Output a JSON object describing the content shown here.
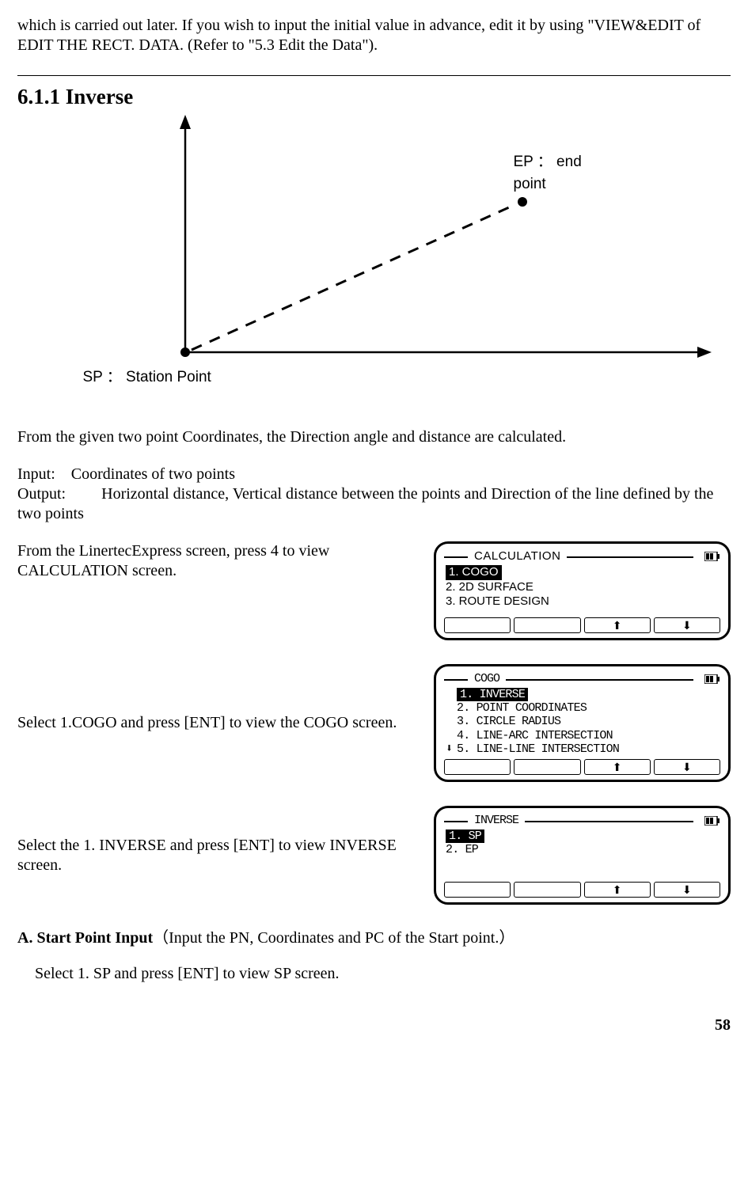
{
  "intro": "which is carried out later. If you wish to input the initial value in advance, edit it by using \"VIEW&EDIT of EDIT THE RECT. DATA. (Refer to \"5.3 Edit the Data\").",
  "section": {
    "heading": "6.1.1 Inverse"
  },
  "diagram": {
    "ep_label_line1": "EP ： end",
    "ep_label_line2": "point",
    "sp_label": "SP ： Station Point"
  },
  "body": {
    "desc": "From the given two point Coordinates, the Direction angle and distance are calculated.",
    "input_label": "Input:",
    "input_text": "Coordinates of two points",
    "output_label": "Output:",
    "output_text": "Horizontal distance, Vertical distance between the points and Direction of the line defined by the two points",
    "step1": "From the LinertecExpress screen, press 4 to view CALCULATION screen.",
    "step2": "Select 1.COGO and press [ENT] to view the COGO screen.",
    "step3": "Select the 1. INVERSE and press [ENT] to view INVERSE screen."
  },
  "screens": {
    "calc": {
      "title": "CALCULATION",
      "items": [
        "1. COGO",
        "2. 2D SURFACE",
        "3. ROUTE DESIGN"
      ],
      "selected_index": 0
    },
    "cogo": {
      "title": "COGO",
      "items": [
        "1. INVERSE",
        "2. POINT COORDINATES",
        "3. CIRCLE RADIUS",
        "4. LINE-ARC INTERSECTION",
        "5. LINE-LINE INTERSECTION"
      ],
      "selected_index": 0
    },
    "inverse": {
      "title": "INVERSE",
      "items": [
        "1. SP",
        "2. EP"
      ],
      "selected_index": 0
    },
    "arrows": {
      "up": "⬆",
      "down": "⬇",
      "down_marker": "⬇"
    }
  },
  "subA": {
    "heading_lead": "A.  Start Point Input",
    "heading_desc": "（Input the PN, Coordinates and PC of the Start point.）",
    "step": "Select 1. SP and press [ENT] to view SP screen."
  },
  "page_number": "58"
}
